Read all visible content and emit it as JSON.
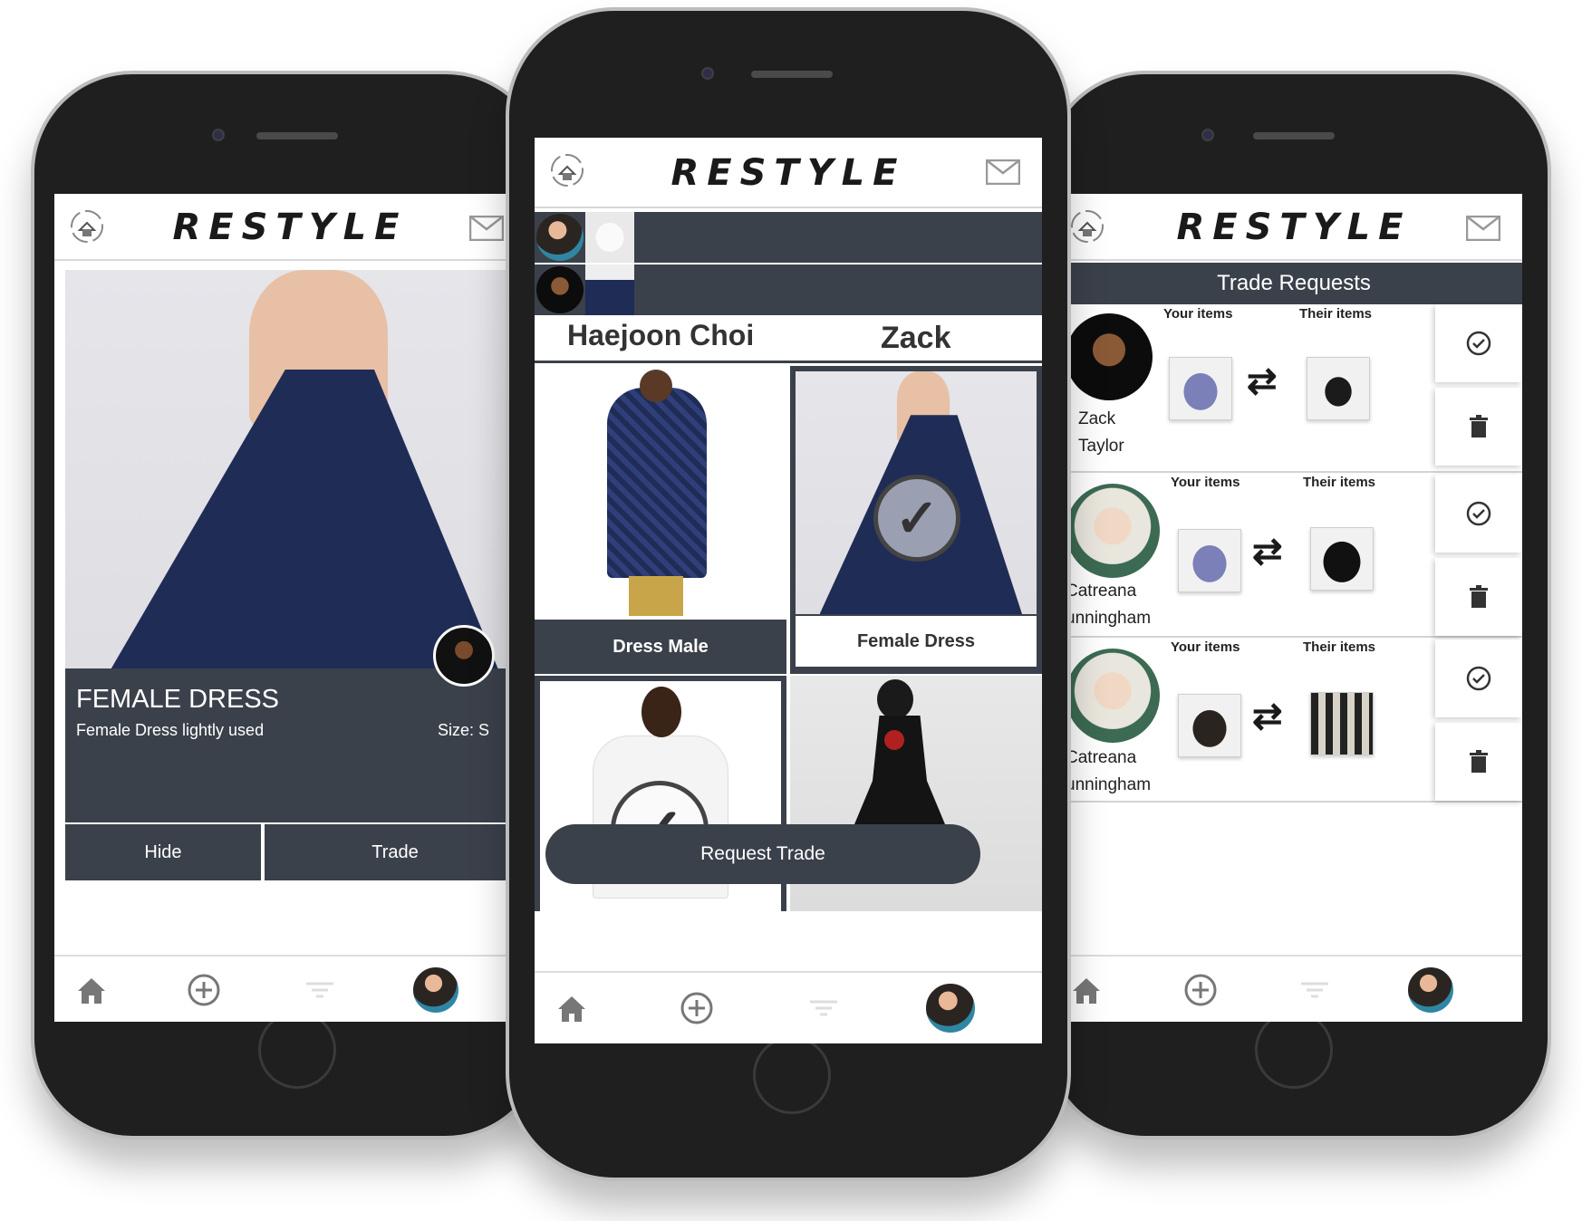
{
  "app": {
    "brand": "RESTYLE"
  },
  "icons": {
    "logo": "hanger-recycle-icon",
    "mail": "mail-icon",
    "home": "home-icon",
    "add": "plus-circle-icon",
    "filter": "filter-icon",
    "check": "check-circle-icon",
    "delete": "trash-icon",
    "swap": "swap-arrows-icon"
  },
  "colors": {
    "dark": "#3b414b",
    "dress_navy": "#1f2c56"
  },
  "left_screen": {
    "item_title": "FEMALE DRESS",
    "description": "Female Dress lightly used",
    "size": "Size: S",
    "hide_label": "Hide",
    "trade_label": "Trade"
  },
  "center_screen": {
    "user_left": "Haejoon Choi",
    "user_right": "Zack",
    "items": [
      {
        "label": "Dress Male",
        "selected": false
      },
      {
        "label": "Female Dress",
        "selected": true
      },
      {
        "label": "",
        "selected": true
      },
      {
        "label": "",
        "selected": false
      }
    ],
    "request_label": "Request Trade"
  },
  "right_screen": {
    "header": "Trade Requests",
    "your_items_label": "Your items",
    "their_items_label": "Their items",
    "requests": [
      {
        "name_line1": "Zack",
        "name_line2": "Taylor"
      },
      {
        "name_line1": "Catreana",
        "name_line2": "unningham"
      },
      {
        "name_line1": "Catreana",
        "name_line2": "unningham"
      }
    ]
  }
}
